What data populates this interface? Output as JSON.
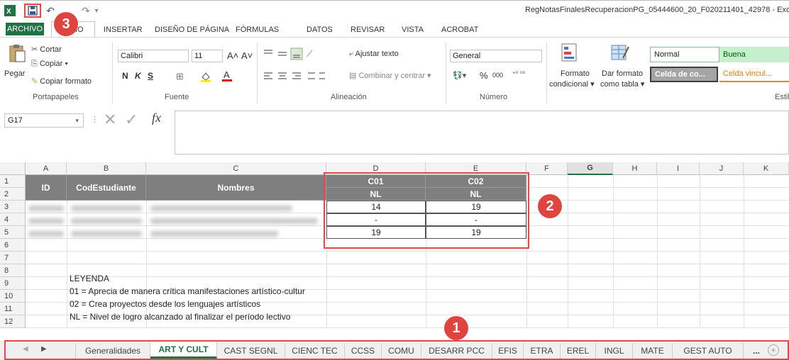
{
  "window": {
    "title": "RegNotasFinalesRecuperacionPG_05444600_20_F020211401_42978 - Exce"
  },
  "ribbon_tabs": [
    "ARCHIVO",
    "INICIO",
    "INSERTAR",
    "DISEÑO DE PÁGINA",
    "FÓRMULAS",
    "DATOS",
    "REVISAR",
    "VISTA",
    "ACROBAT"
  ],
  "tab_inicio_visible": "IO",
  "clipboard": {
    "paste": "Pegar",
    "cut": "Cortar",
    "copy": "Copiar",
    "format_painter": "Copiar formato",
    "group": "Portapapeles"
  },
  "font": {
    "name": "Calibri",
    "size": "11",
    "bold": "N",
    "italic": "K",
    "underline": "S",
    "group": "Fuente"
  },
  "alignment": {
    "wrap": "Ajustar texto",
    "merge": "Combinar y centrar",
    "group": "Alineación"
  },
  "number": {
    "format": "General",
    "percent": "%",
    "thousands": "000",
    "group": "Número"
  },
  "styles": {
    "cond_format_line1": "Formato",
    "cond_format_line2": "condicional",
    "table_format_line1": "Dar formato",
    "table_format_line2": "como tabla",
    "normal": "Normal",
    "good": "Buena",
    "check_cell": "Celda de co...",
    "linked_cell": "Celda vincul...",
    "group": "Estil"
  },
  "formula_bar": {
    "name_box": "G17",
    "fx": "fx",
    "value": ""
  },
  "columns": [
    "A",
    "B",
    "C",
    "D",
    "E",
    "F",
    "G",
    "H",
    "I",
    "J",
    "K"
  ],
  "rows": [
    "1",
    "2",
    "3",
    "4",
    "5",
    "6",
    "7",
    "8",
    "9",
    "10",
    "11",
    "12"
  ],
  "table": {
    "id_header": "ID",
    "cod_header": "CodEstudiante",
    "name_header": "Nombres",
    "c01": "C01",
    "c02": "C02",
    "nl1": "NL",
    "nl2": "NL",
    "scores": [
      [
        "14",
        "19"
      ],
      [
        "-",
        "-"
      ],
      [
        "19",
        "19"
      ]
    ]
  },
  "legend": {
    "title": "LEYENDA",
    "line1": "01 = Aprecia de manera crítica manifestaciones artístico-cultur",
    "line2": "02 = Crea proyectos desde los lenguajes artísticos",
    "line3": "NL = Nivel de logro alcanzado al finalizar el período lectivo"
  },
  "sheet_tabs": [
    "Generalidades",
    "ART Y CULT",
    "CAST SEGNL",
    "CIENC TEC",
    "CCSS",
    "COMU",
    "DESARR PCC",
    "EFIS",
    "ETRA",
    "EREL",
    "INGL",
    "MATE",
    "GEST AUTO",
    "..."
  ],
  "active_sheet": "ART Y CULT",
  "badges": [
    "1",
    "2",
    "3"
  ],
  "colors": {
    "excel_green": "#217346",
    "annotation_red": "#e24a4a",
    "header_gray": "#7f7f7f"
  }
}
